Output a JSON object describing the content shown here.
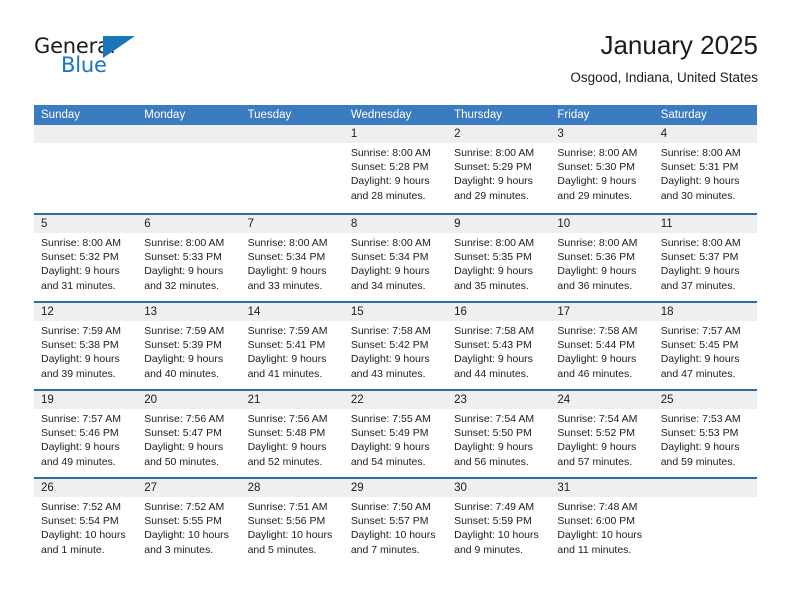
{
  "brand": {
    "word_one": "General",
    "word_two": "Blue",
    "flag_icon": "blue-triangle-flag"
  },
  "header": {
    "title": "January 2025",
    "location": "Osgood, Indiana, United States"
  },
  "colors": {
    "header_blue": "#3b7cc0",
    "week_divider_blue": "#2b6cab",
    "daynum_gray": "#efefef",
    "brand_blue": "#1b75bb",
    "text": "#1c1c1c"
  },
  "calendar": {
    "day_headers": [
      "Sunday",
      "Monday",
      "Tuesday",
      "Wednesday",
      "Thursday",
      "Friday",
      "Saturday"
    ],
    "labels": {
      "sunrise": "Sunrise:",
      "sunset": "Sunset:",
      "daylight": "Daylight:"
    },
    "weeks": [
      [
        {
          "empty": true
        },
        {
          "empty": true
        },
        {
          "empty": true
        },
        {
          "day": "1",
          "sunrise": "Sunrise: 8:00 AM",
          "sunset": "Sunset: 5:28 PM",
          "daylight_1": "Daylight: 9 hours",
          "daylight_2": "and 28 minutes."
        },
        {
          "day": "2",
          "sunrise": "Sunrise: 8:00 AM",
          "sunset": "Sunset: 5:29 PM",
          "daylight_1": "Daylight: 9 hours",
          "daylight_2": "and 29 minutes."
        },
        {
          "day": "3",
          "sunrise": "Sunrise: 8:00 AM",
          "sunset": "Sunset: 5:30 PM",
          "daylight_1": "Daylight: 9 hours",
          "daylight_2": "and 29 minutes."
        },
        {
          "day": "4",
          "sunrise": "Sunrise: 8:00 AM",
          "sunset": "Sunset: 5:31 PM",
          "daylight_1": "Daylight: 9 hours",
          "daylight_2": "and 30 minutes."
        }
      ],
      [
        {
          "day": "5",
          "sunrise": "Sunrise: 8:00 AM",
          "sunset": "Sunset: 5:32 PM",
          "daylight_1": "Daylight: 9 hours",
          "daylight_2": "and 31 minutes."
        },
        {
          "day": "6",
          "sunrise": "Sunrise: 8:00 AM",
          "sunset": "Sunset: 5:33 PM",
          "daylight_1": "Daylight: 9 hours",
          "daylight_2": "and 32 minutes."
        },
        {
          "day": "7",
          "sunrise": "Sunrise: 8:00 AM",
          "sunset": "Sunset: 5:34 PM",
          "daylight_1": "Daylight: 9 hours",
          "daylight_2": "and 33 minutes."
        },
        {
          "day": "8",
          "sunrise": "Sunrise: 8:00 AM",
          "sunset": "Sunset: 5:34 PM",
          "daylight_1": "Daylight: 9 hours",
          "daylight_2": "and 34 minutes."
        },
        {
          "day": "9",
          "sunrise": "Sunrise: 8:00 AM",
          "sunset": "Sunset: 5:35 PM",
          "daylight_1": "Daylight: 9 hours",
          "daylight_2": "and 35 minutes."
        },
        {
          "day": "10",
          "sunrise": "Sunrise: 8:00 AM",
          "sunset": "Sunset: 5:36 PM",
          "daylight_1": "Daylight: 9 hours",
          "daylight_2": "and 36 minutes."
        },
        {
          "day": "11",
          "sunrise": "Sunrise: 8:00 AM",
          "sunset": "Sunset: 5:37 PM",
          "daylight_1": "Daylight: 9 hours",
          "daylight_2": "and 37 minutes."
        }
      ],
      [
        {
          "day": "12",
          "sunrise": "Sunrise: 7:59 AM",
          "sunset": "Sunset: 5:38 PM",
          "daylight_1": "Daylight: 9 hours",
          "daylight_2": "and 39 minutes."
        },
        {
          "day": "13",
          "sunrise": "Sunrise: 7:59 AM",
          "sunset": "Sunset: 5:39 PM",
          "daylight_1": "Daylight: 9 hours",
          "daylight_2": "and 40 minutes."
        },
        {
          "day": "14",
          "sunrise": "Sunrise: 7:59 AM",
          "sunset": "Sunset: 5:41 PM",
          "daylight_1": "Daylight: 9 hours",
          "daylight_2": "and 41 minutes."
        },
        {
          "day": "15",
          "sunrise": "Sunrise: 7:58 AM",
          "sunset": "Sunset: 5:42 PM",
          "daylight_1": "Daylight: 9 hours",
          "daylight_2": "and 43 minutes."
        },
        {
          "day": "16",
          "sunrise": "Sunrise: 7:58 AM",
          "sunset": "Sunset: 5:43 PM",
          "daylight_1": "Daylight: 9 hours",
          "daylight_2": "and 44 minutes."
        },
        {
          "day": "17",
          "sunrise": "Sunrise: 7:58 AM",
          "sunset": "Sunset: 5:44 PM",
          "daylight_1": "Daylight: 9 hours",
          "daylight_2": "and 46 minutes."
        },
        {
          "day": "18",
          "sunrise": "Sunrise: 7:57 AM",
          "sunset": "Sunset: 5:45 PM",
          "daylight_1": "Daylight: 9 hours",
          "daylight_2": "and 47 minutes."
        }
      ],
      [
        {
          "day": "19",
          "sunrise": "Sunrise: 7:57 AM",
          "sunset": "Sunset: 5:46 PM",
          "daylight_1": "Daylight: 9 hours",
          "daylight_2": "and 49 minutes."
        },
        {
          "day": "20",
          "sunrise": "Sunrise: 7:56 AM",
          "sunset": "Sunset: 5:47 PM",
          "daylight_1": "Daylight: 9 hours",
          "daylight_2": "and 50 minutes."
        },
        {
          "day": "21",
          "sunrise": "Sunrise: 7:56 AM",
          "sunset": "Sunset: 5:48 PM",
          "daylight_1": "Daylight: 9 hours",
          "daylight_2": "and 52 minutes."
        },
        {
          "day": "22",
          "sunrise": "Sunrise: 7:55 AM",
          "sunset": "Sunset: 5:49 PM",
          "daylight_1": "Daylight: 9 hours",
          "daylight_2": "and 54 minutes."
        },
        {
          "day": "23",
          "sunrise": "Sunrise: 7:54 AM",
          "sunset": "Sunset: 5:50 PM",
          "daylight_1": "Daylight: 9 hours",
          "daylight_2": "and 56 minutes."
        },
        {
          "day": "24",
          "sunrise": "Sunrise: 7:54 AM",
          "sunset": "Sunset: 5:52 PM",
          "daylight_1": "Daylight: 9 hours",
          "daylight_2": "and 57 minutes."
        },
        {
          "day": "25",
          "sunrise": "Sunrise: 7:53 AM",
          "sunset": "Sunset: 5:53 PM",
          "daylight_1": "Daylight: 9 hours",
          "daylight_2": "and 59 minutes."
        }
      ],
      [
        {
          "day": "26",
          "sunrise": "Sunrise: 7:52 AM",
          "sunset": "Sunset: 5:54 PM",
          "daylight_1": "Daylight: 10 hours",
          "daylight_2": "and 1 minute."
        },
        {
          "day": "27",
          "sunrise": "Sunrise: 7:52 AM",
          "sunset": "Sunset: 5:55 PM",
          "daylight_1": "Daylight: 10 hours",
          "daylight_2": "and 3 minutes."
        },
        {
          "day": "28",
          "sunrise": "Sunrise: 7:51 AM",
          "sunset": "Sunset: 5:56 PM",
          "daylight_1": "Daylight: 10 hours",
          "daylight_2": "and 5 minutes."
        },
        {
          "day": "29",
          "sunrise": "Sunrise: 7:50 AM",
          "sunset": "Sunset: 5:57 PM",
          "daylight_1": "Daylight: 10 hours",
          "daylight_2": "and 7 minutes."
        },
        {
          "day": "30",
          "sunrise": "Sunrise: 7:49 AM",
          "sunset": "Sunset: 5:59 PM",
          "daylight_1": "Daylight: 10 hours",
          "daylight_2": "and 9 minutes."
        },
        {
          "day": "31",
          "sunrise": "Sunrise: 7:48 AM",
          "sunset": "Sunset: 6:00 PM",
          "daylight_1": "Daylight: 10 hours",
          "daylight_2": "and 11 minutes."
        },
        {
          "empty": true
        }
      ]
    ]
  }
}
